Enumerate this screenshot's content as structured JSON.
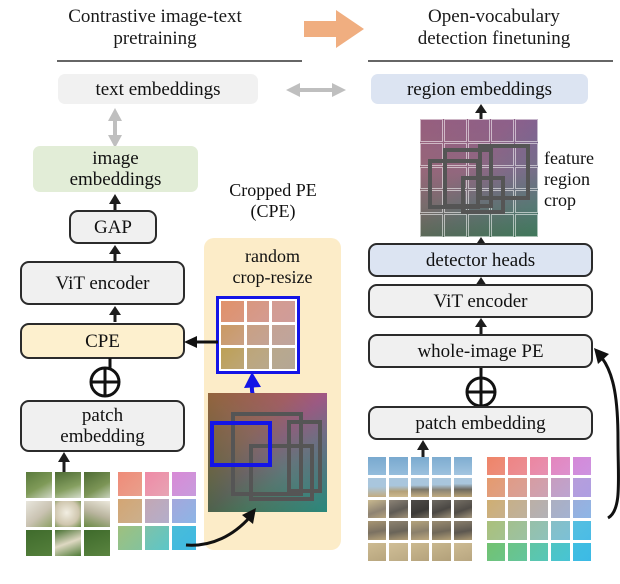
{
  "left_panel": {
    "title": "Contrastive image-text pretraining",
    "title_lines": [
      "Contrastive image-text",
      "pretraining"
    ],
    "blocks": {
      "text_embeddings": "text embeddings",
      "image_embeddings_lines": [
        "image",
        "embeddings"
      ],
      "gap": "GAP",
      "vit_encoder": "ViT encoder",
      "cpe": "CPE",
      "patch_embedding_lines": [
        "patch",
        "embedding"
      ],
      "plus_symbol": "⊕"
    },
    "colors": {
      "text_embeddings_bg": "#f1f1f1",
      "image_embeddings_bg": "#e2edd7",
      "cpe_bg": "#fdf0ce",
      "box_bg": "#f0f0f0",
      "box_border": "#2b2b2b"
    }
  },
  "right_panel": {
    "title": "Open-vocabulary detection finetuning",
    "title_lines": [
      "Open-vocabulary",
      "detection finetuning"
    ],
    "blocks": {
      "region_embeddings": "region embeddings",
      "detector_heads": "detector heads",
      "vit_encoder": "ViT encoder",
      "whole_image_pe": "whole-image PE",
      "patch_embedding": "patch embedding",
      "plus_symbol": "⊕"
    },
    "annotation_lines": [
      "feature",
      "region",
      "crop"
    ],
    "colors": {
      "region_embeddings_bg": "#dce4f2",
      "detector_heads_bg": "#dce4f2",
      "box_bg": "#f0f0f0"
    }
  },
  "cpe_panel": {
    "title_lines": [
      "Cropped PE",
      "(CPE)"
    ],
    "operation_lines": [
      "random",
      "crop-resize"
    ],
    "colors": {
      "panel_bg": "#fcecc8",
      "crop_border": "#1414e6",
      "box_border": "#555555"
    },
    "cropped_grid": {
      "rows": 3,
      "cols": 3,
      "cells": [
        "#e1916a",
        "#d9977f",
        "#d49b91",
        "#cb9a63",
        "#c9a083",
        "#c4a394",
        "#bda055",
        "#bda678",
        "#b9a88c"
      ]
    }
  },
  "transition_arrow": {
    "name": "stage-transition-arrow",
    "color": "#f0ae80"
  },
  "alignment_arrow": {
    "name": "bidirectional-alignment-arrow",
    "color": "#bfbfbf"
  },
  "chart_data": {
    "type": "diagram",
    "title": "Contrastive pretraining with Cropped PE and open-vocabulary detection finetuning",
    "nodes": [
      {
        "id": "text_embeddings",
        "label": "text embeddings",
        "panel": "left",
        "fill": "#f1f1f1"
      },
      {
        "id": "image_embeddings",
        "label": "image embeddings",
        "panel": "left",
        "fill": "#e2edd7"
      },
      {
        "id": "gap",
        "label": "GAP",
        "panel": "left",
        "fill": "#f0f0f0"
      },
      {
        "id": "vit_encoder_left",
        "label": "ViT encoder",
        "panel": "left",
        "fill": "#f0f0f0"
      },
      {
        "id": "cpe",
        "label": "CPE",
        "panel": "left",
        "fill": "#fdf0ce"
      },
      {
        "id": "patch_embedding_left",
        "label": "patch embedding",
        "panel": "left",
        "fill": "#f0f0f0"
      },
      {
        "id": "cropped_pe",
        "label": "random crop-resize",
        "panel": "middle",
        "fill": "#fcecc8"
      },
      {
        "id": "region_embeddings",
        "label": "region embeddings",
        "panel": "right",
        "fill": "#dce4f2"
      },
      {
        "id": "detector_heads",
        "label": "detector heads",
        "panel": "right",
        "fill": "#dce4f2"
      },
      {
        "id": "vit_encoder_right",
        "label": "ViT encoder",
        "panel": "right",
        "fill": "#f0f0f0"
      },
      {
        "id": "whole_image_pe",
        "label": "whole-image PE",
        "panel": "right",
        "fill": "#f0f0f0"
      },
      {
        "id": "patch_embedding_right",
        "label": "patch embedding",
        "panel": "right",
        "fill": "#f0f0f0"
      }
    ],
    "edges": [
      {
        "from": "patch_embedding_left",
        "to": "cpe",
        "kind": "sum"
      },
      {
        "from": "cpe",
        "to": "vit_encoder_left",
        "kind": "arrow"
      },
      {
        "from": "vit_encoder_left",
        "to": "gap",
        "kind": "arrow"
      },
      {
        "from": "gap",
        "to": "image_embeddings",
        "kind": "arrow"
      },
      {
        "from": "image_embeddings",
        "to": "text_embeddings",
        "kind": "bidirectional"
      },
      {
        "from": "text_embeddings",
        "to": "region_embeddings",
        "kind": "bidirectional"
      },
      {
        "from": "cropped_pe",
        "to": "cpe",
        "kind": "arrow"
      },
      {
        "from": "patch_embedding_right",
        "to": "whole_image_pe",
        "kind": "sum"
      },
      {
        "from": "whole_image_pe",
        "to": "vit_encoder_right",
        "kind": "arrow"
      },
      {
        "from": "vit_encoder_right",
        "to": "detector_heads",
        "kind": "arrow"
      },
      {
        "from": "detector_heads",
        "to": "region_embeddings",
        "kind": "arrow"
      }
    ]
  }
}
